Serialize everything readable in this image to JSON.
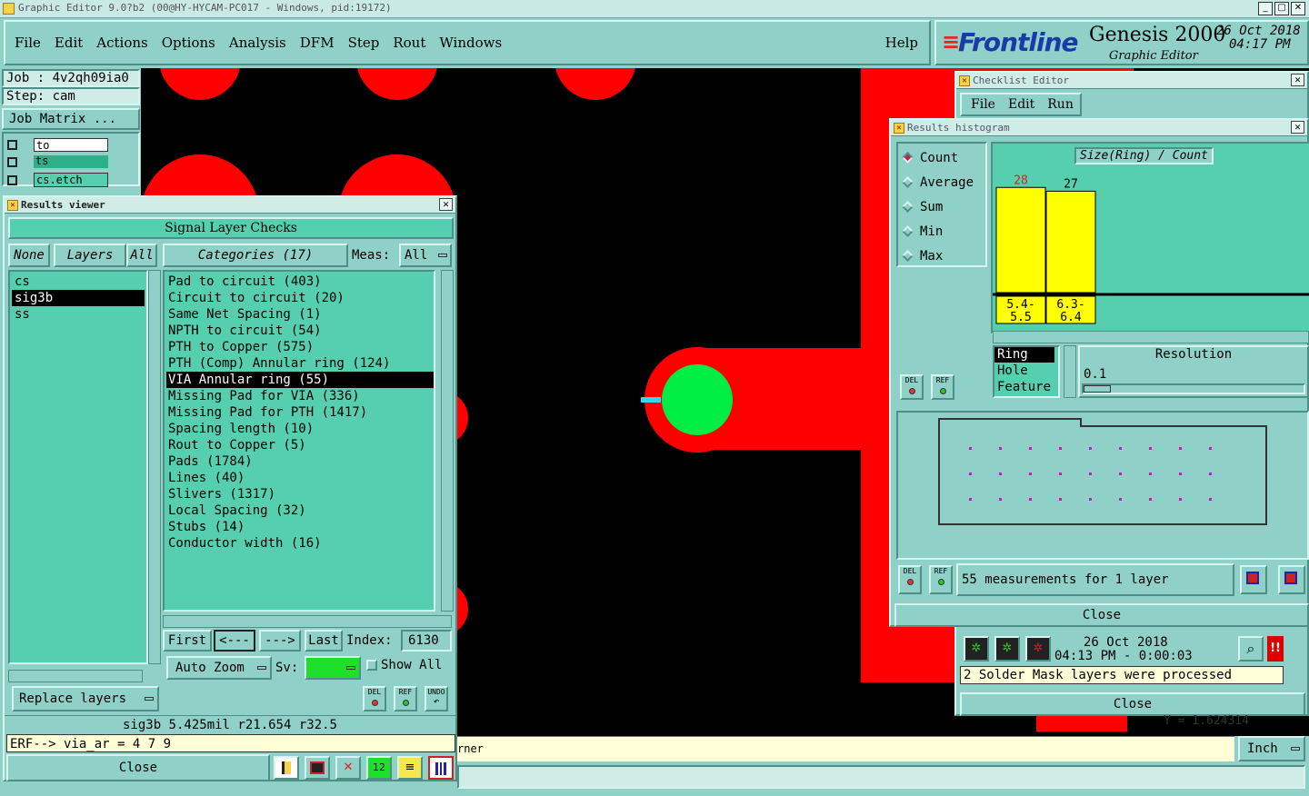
{
  "titlebar": {
    "title": "Graphic Editor 9.0?b2 (00@HY-HYCAM-PC017 - Windows, pid:19172)"
  },
  "menu": {
    "items": [
      "File",
      "Edit",
      "Actions",
      "Options",
      "Analysis",
      "DFM",
      "Step",
      "Rout",
      "Windows"
    ],
    "help": "Help"
  },
  "brand": {
    "logo": "Frontline",
    "product": "Genesis 2000",
    "sub": "Graphic Editor",
    "date": "26 Oct 2018",
    "time": "04:17 PM"
  },
  "job": {
    "job": "Job : 4v2qh09ia0",
    "step": "Step: cam",
    "matrix_btn": "Job Matrix ..."
  },
  "layers_side": [
    {
      "name": "to",
      "color": "#ffffff"
    },
    {
      "name": "ts",
      "color": "#2bb08a"
    },
    {
      "name": "cs.etch",
      "color": "#55cfb0"
    }
  ],
  "results_viewer": {
    "title": "Results viewer",
    "header": "Signal Layer Checks",
    "none": "None",
    "layers": "Layers",
    "all": "All",
    "categories_btn": "Categories (17)",
    "meas_label": "Meas:",
    "meas_value": "All",
    "layer_list": [
      "cs",
      "sig3b",
      "ss"
    ],
    "selected_layer": 1,
    "categories": [
      "Pad to circuit (403)",
      "Circuit to circuit (20)",
      "Same Net Spacing (1)",
      "NPTH to circuit (54)",
      "PTH to Copper (575)",
      "PTH (Comp) Annular ring (124)",
      "VIA Annular ring (55)",
      "Missing Pad for VIA (336)",
      "Missing Pad for PTH (1417)",
      "Spacing length (10)",
      "Rout to Copper (5)",
      "Pads (1784)",
      "Lines (40)",
      "Slivers (1317)",
      "Local Spacing (32)",
      "Stubs (14)",
      "Conductor width (16)"
    ],
    "selected_category": 6,
    "first": "First",
    "prev": "<---",
    "next": "--->",
    "last": "Last",
    "index_label": "Index:",
    "index_value": "6130",
    "auto_zoom": "Auto Zoom",
    "sv_label": "Sv:",
    "show_all": "Show All",
    "replace": "Replace layers",
    "del": "DEL",
    "ref": "REF",
    "undo": "UNDO",
    "status": "sig3b 5.425mil  r21.654  r32.5",
    "erf": "ERF--> via_ar = 4 7 9",
    "close": "Close"
  },
  "checklist": {
    "title": "Checklist Editor",
    "menu": [
      "File",
      "Edit",
      "Run"
    ],
    "date": "26 Oct 2018",
    "time": "04:13 PM - 0:00:03",
    "message": "2 Solder Mask layers were processed",
    "close": "Close"
  },
  "histogram": {
    "title": "Results histogram",
    "modes": [
      "Count",
      "Average",
      "Sum",
      "Min",
      "Max"
    ],
    "selected_mode": 0,
    "chart_title": "Size(Ring) / Count",
    "del": "DEL",
    "ref": "REF",
    "attrs": [
      "Ring",
      "Hole",
      "Feature"
    ],
    "selected_attr": 0,
    "resolution_label": "Resolution",
    "resolution_value": "0.1",
    "summary": "55 measurements for 1 layer",
    "close": "Close"
  },
  "chart_data": {
    "type": "bar",
    "title": "Size(Ring) / Count",
    "categories": [
      "5.4-5.5",
      "6.3-6.4"
    ],
    "values": [
      28,
      27
    ],
    "ylim": [
      0,
      30
    ],
    "bar_color": "#ffff00",
    "label_colors": [
      "#e02020",
      "#000000"
    ]
  },
  "bottom": {
    "prompt": "rner",
    "unit": "Inch",
    "coord": "Y = 1.624314"
  },
  "canvas": {
    "pad_color": "#ff0000",
    "hole_color": "#00ee44",
    "bg": "#000000"
  }
}
